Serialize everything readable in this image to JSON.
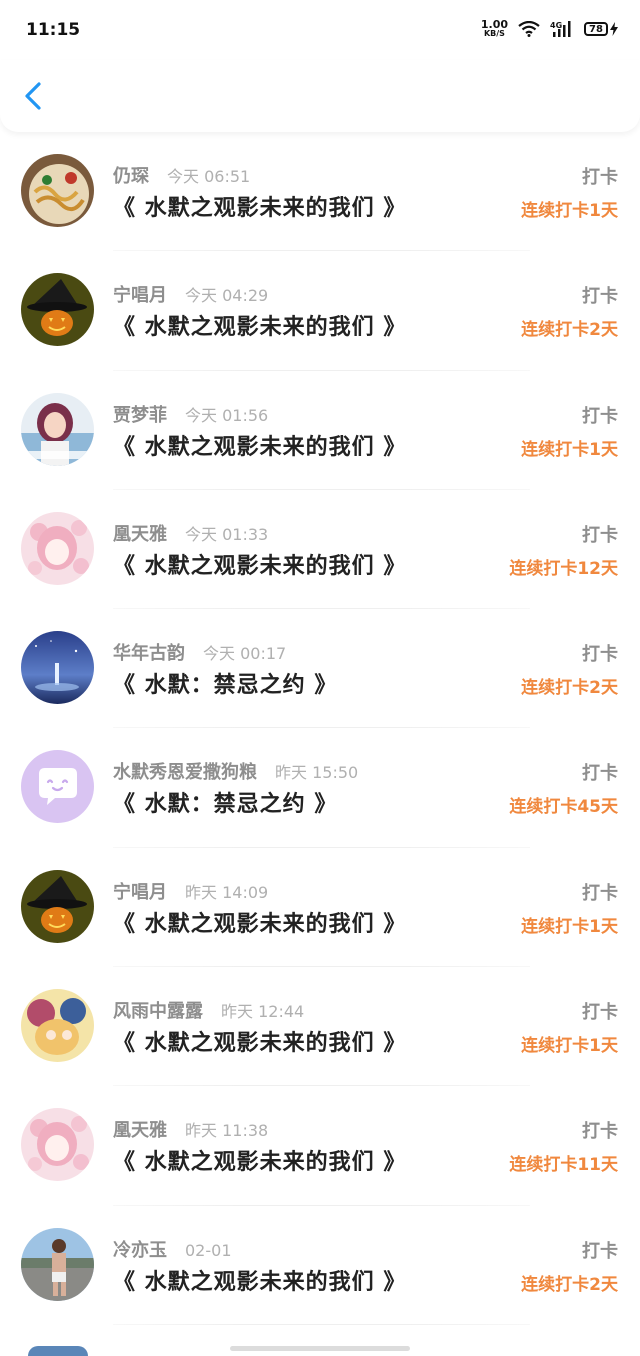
{
  "status": {
    "time": "11:15",
    "netspeed": "1.00",
    "netspeed_unit": "KB/S",
    "network": "4G",
    "battery": "78"
  },
  "header": {
    "back_icon": "chevron-left-icon"
  },
  "colors": {
    "accent": "#2196f3",
    "streak": "#f0883e",
    "muted": "#8e8e8e"
  },
  "items": [
    {
      "name": "仍琛",
      "time": "今天 06:51",
      "title": "《 水默之观影未来的我们 》",
      "type": "打卡",
      "streak": "连续打卡1天",
      "avatar": "noodles"
    },
    {
      "name": "宁唱月",
      "time": "今天 04:29",
      "title": "《 水默之观影未来的我们 》",
      "type": "打卡",
      "streak": "连续打卡2天",
      "avatar": "pumpkin"
    },
    {
      "name": "贾梦菲",
      "time": "今天 01:56",
      "title": "《 水默之观影未来的我们 》",
      "type": "打卡",
      "streak": "连续打卡1天",
      "avatar": "girl"
    },
    {
      "name": "凰天雅",
      "time": "今天 01:33",
      "title": "《 水默之观影未来的我们 》",
      "type": "打卡",
      "streak": "连续打卡12天",
      "avatar": "anime-pink"
    },
    {
      "name": "华年古韵",
      "time": "今天 00:17",
      "title": "《 水默：禁忌之约 》",
      "type": "打卡",
      "streak": "连续打卡2天",
      "avatar": "galaxy"
    },
    {
      "name": "水默秀恩爱撒狗粮",
      "time": "昨天 15:50",
      "title": "《 水默：禁忌之约 》",
      "type": "打卡",
      "streak": "连续打卡45天",
      "avatar": "chat-bubble"
    },
    {
      "name": "宁唱月",
      "time": "昨天 14:09",
      "title": "《 水默之观影未来的我们 》",
      "type": "打卡",
      "streak": "连续打卡1天",
      "avatar": "pumpkin"
    },
    {
      "name": "风雨中露露",
      "time": "昨天 12:44",
      "title": "《 水默之观影未来的我们 》",
      "type": "打卡",
      "streak": "连续打卡1天",
      "avatar": "anime-colorful"
    },
    {
      "name": "凰天雅",
      "time": "昨天 11:38",
      "title": "《 水默之观影未来的我们 》",
      "type": "打卡",
      "streak": "连续打卡11天",
      "avatar": "anime-pink"
    },
    {
      "name": "冷亦玉",
      "time": "02-01",
      "title": "《 水默之观影未来的我们 》",
      "type": "打卡",
      "streak": "连续打卡2天",
      "avatar": "person-photo"
    }
  ]
}
